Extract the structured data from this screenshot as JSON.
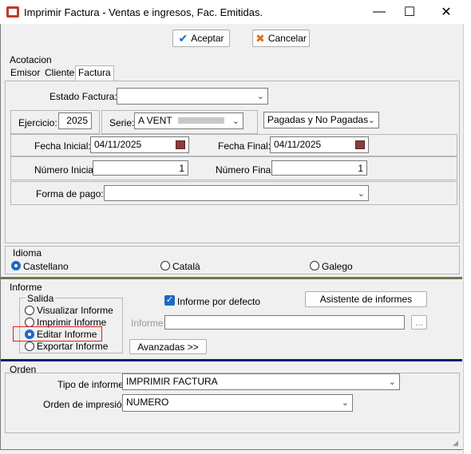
{
  "window": {
    "title": "Imprimir Factura - Ventas e ingresos, Fac. Emitidas.",
    "min": "—",
    "max": "☐",
    "close": "✕"
  },
  "toolbar": {
    "accept_label": "Aceptar",
    "cancel_label": "Cancelar",
    "accept_icon": "check-icon",
    "cancel_icon": "cancel-icon"
  },
  "acotacion": {
    "title": "Acotacion",
    "tabs": [
      "Emisor",
      "Cliente",
      "Factura"
    ],
    "active_tab": "Factura",
    "estado_label": "Estado Factura:",
    "estado_value": "",
    "ejercicio_label": "Ejercicio:",
    "ejercicio_value": "2025",
    "serie_label": "Serie:",
    "serie_value": "A  VENT",
    "pagadas_value": "Pagadas y No Pagadas",
    "fecha_ini_label": "Fecha Inicial:",
    "fecha_ini_value": "04/11/2025",
    "fecha_fin_label": "Fecha Final:",
    "fecha_fin_value": "04/11/2025",
    "num_ini_label": "Número Inicial:",
    "num_ini_value": "1",
    "num_fin_label": "Número Final:",
    "num_fin_value": "1",
    "forma_pago_label": "Forma de pago:",
    "forma_pago_value": ""
  },
  "idioma": {
    "title": "Idioma",
    "options": [
      "Castellano",
      "Català",
      "Galego"
    ],
    "selected": "Castellano"
  },
  "informe": {
    "title": "Informe",
    "salida_title": "Salida",
    "salida_options": [
      "Visualizar Informe",
      "Imprimir Informe",
      "Editar Informe",
      "Exportar Informe"
    ],
    "salida_selected": "Editar Informe",
    "por_defecto_label": "Informe por defecto",
    "por_defecto_checked": true,
    "asistente_label": "Asistente de informes",
    "informe_label": "Informe:",
    "informe_value": "",
    "browse_label": "...",
    "avanzadas_label": "Avanzadas >>"
  },
  "orden": {
    "title": "Orden",
    "tipo_label": "Tipo de informe",
    "tipo_value": "IMPRIMIR FACTURA",
    "orden_label": "Orden de impresión:",
    "orden_value": "NUMERO"
  },
  "colors": {
    "accent": "#1b6ac9",
    "highlight": "#e02020",
    "olive": "#77724a",
    "navy": "#0a1f6e"
  }
}
